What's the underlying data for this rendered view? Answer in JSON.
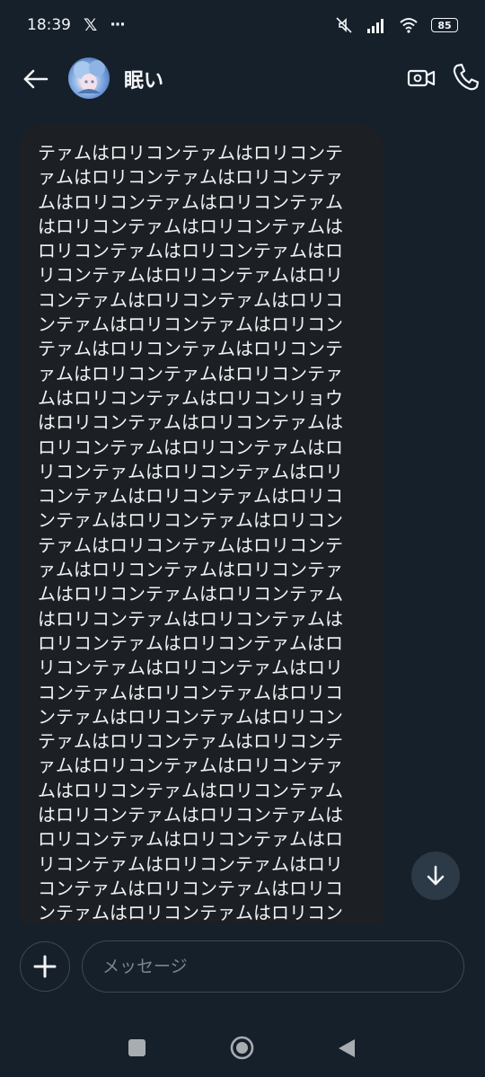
{
  "status_bar": {
    "time": "18:39",
    "x_logo": "𝕏",
    "more": "···",
    "battery": "85",
    "icons": [
      "mute-icon",
      "signal-icon",
      "wifi-icon",
      "battery-icon"
    ]
  },
  "header": {
    "title": "眠い",
    "back_icon": "arrow-left-icon",
    "video_icon": "video-camera-icon",
    "call_icon": "phone-icon"
  },
  "message": {
    "lines": [
      "テァムはロリコンテァムはロリコンテ",
      "ァムはロリコンテァムはロリコンテァ",
      "ムはロリコンテァムはロリコンテァム",
      "はロリコンテァムはロリコンテァムは",
      "ロリコンテァムはロリコンテァムはロ",
      "リコンテァムはロリコンテァムはロリ",
      "コンテァムはロリコンテァムはロリコ",
      "ンテァムはロリコンテァムはロリコン",
      "テァムはロリコンテァムはロリコンテ",
      "ァムはロリコンテァムはロリコンテァ",
      "ムはロリコンテァムはロリコンリョウ",
      "はロリコンテァムはロリコンテァムは",
      "ロリコンテァムはロリコンテァムはロ",
      "リコンテァムはロリコンテァムはロリ",
      "コンテァムはロリコンテァムはロリコ",
      "ンテァムはロリコンテァムはロリコン",
      "テァムはロリコンテァムはロリコンテ",
      "ァムはロリコンテァムはロリコンテァ",
      "ムはロリコンテァムはロリコンテァム",
      "はロリコンテァムはロリコンテァムは",
      "ロリコンテァムはロリコンテァムはロ",
      "リコンテァムはロリコンテァムはロリ",
      "コンテァムはロリコンテァムはロリコ",
      "ンテァムはロリコンテァムはロリコン",
      "テァムはロリコンテァムはロリコンテ",
      "ァムはロリコンテァムはロリコンテァ",
      "ムはロリコンテァムはロリコンテァム",
      "はロリコンテァムはロリコンテァムは",
      "ロリコンテァムはロリコンテァムはロ",
      "リコンテァムはロリコンテァムはロリ",
      "コンテァムはロリコンテァムはロリコ",
      "ンテァムはロリコンテァムはロリコン"
    ]
  },
  "composer": {
    "placeholder": "メッセージ",
    "add_icon": "plus-icon",
    "scroll_icon": "arrow-down-icon"
  },
  "nav": {
    "recents_icon": "square-icon",
    "home_icon": "circle-icon",
    "back_icon": "triangle-back-icon"
  }
}
